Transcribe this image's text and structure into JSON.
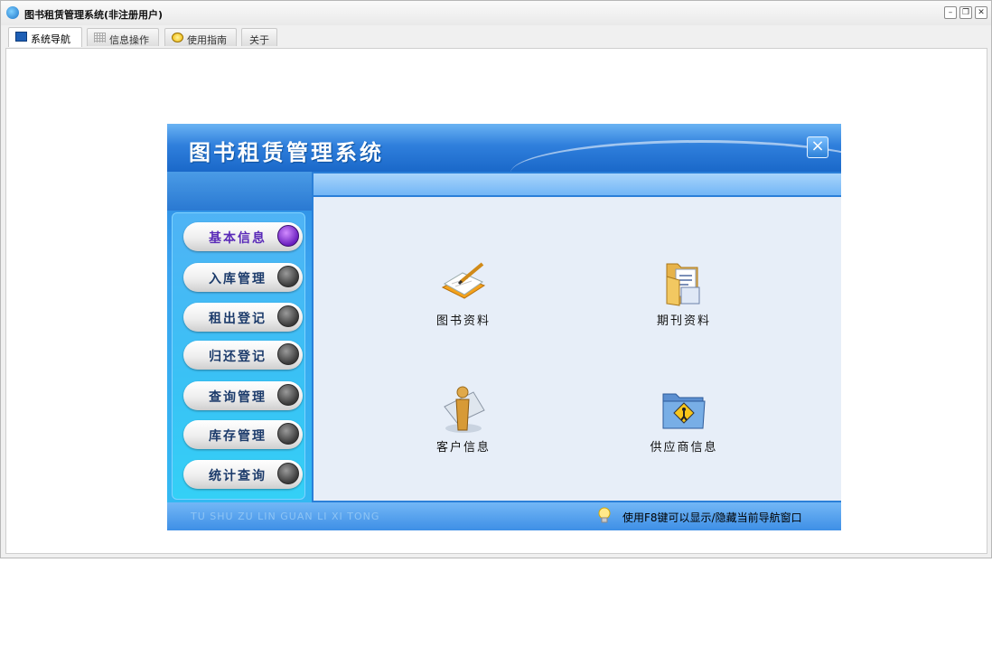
{
  "window": {
    "title": "图书租赁管理系统(非注册用户)",
    "controls": [
      "minimize",
      "restore",
      "close"
    ]
  },
  "tabs": [
    {
      "label": "系统导航",
      "icon": "monitor-icon",
      "active": true
    },
    {
      "label": "信息操作",
      "icon": "grid-icon",
      "active": false
    },
    {
      "label": "使用指南",
      "icon": "lightbulb-icon",
      "active": false
    },
    {
      "label": "关于",
      "icon": "",
      "active": false
    }
  ],
  "nav": {
    "title": "图书租赁管理系统",
    "close_symbol": "×",
    "menu": [
      {
        "label": "基本信息",
        "active": true
      },
      {
        "label": "入库管理",
        "active": false
      },
      {
        "label": "租出登记",
        "active": false
      },
      {
        "label": "归还登记",
        "active": false
      },
      {
        "label": "查询管理",
        "active": false
      },
      {
        "label": "库存管理",
        "active": false
      },
      {
        "label": "统计查询",
        "active": false
      }
    ],
    "tiles": [
      {
        "label": "图书资料",
        "icon": "book-edit-icon"
      },
      {
        "label": "期刊资料",
        "icon": "folder-documents-icon"
      },
      {
        "label": "客户信息",
        "icon": "customer-person-icon"
      },
      {
        "label": "供应商信息",
        "icon": "supplier-folder-icon"
      }
    ],
    "footer": {
      "pinyin": "TU SHU ZU LIN  GUAN LI XI TONG",
      "tip": "使用F8键可以显示/隐藏当前导航窗口"
    }
  },
  "colors": {
    "header_blue": "#2f7fdc",
    "sidebar_cyan": "#34d0f6",
    "main_bg": "#e7eef8",
    "active_dot": "#6a1fbf",
    "inactive_dot": "#3a3a3a"
  }
}
